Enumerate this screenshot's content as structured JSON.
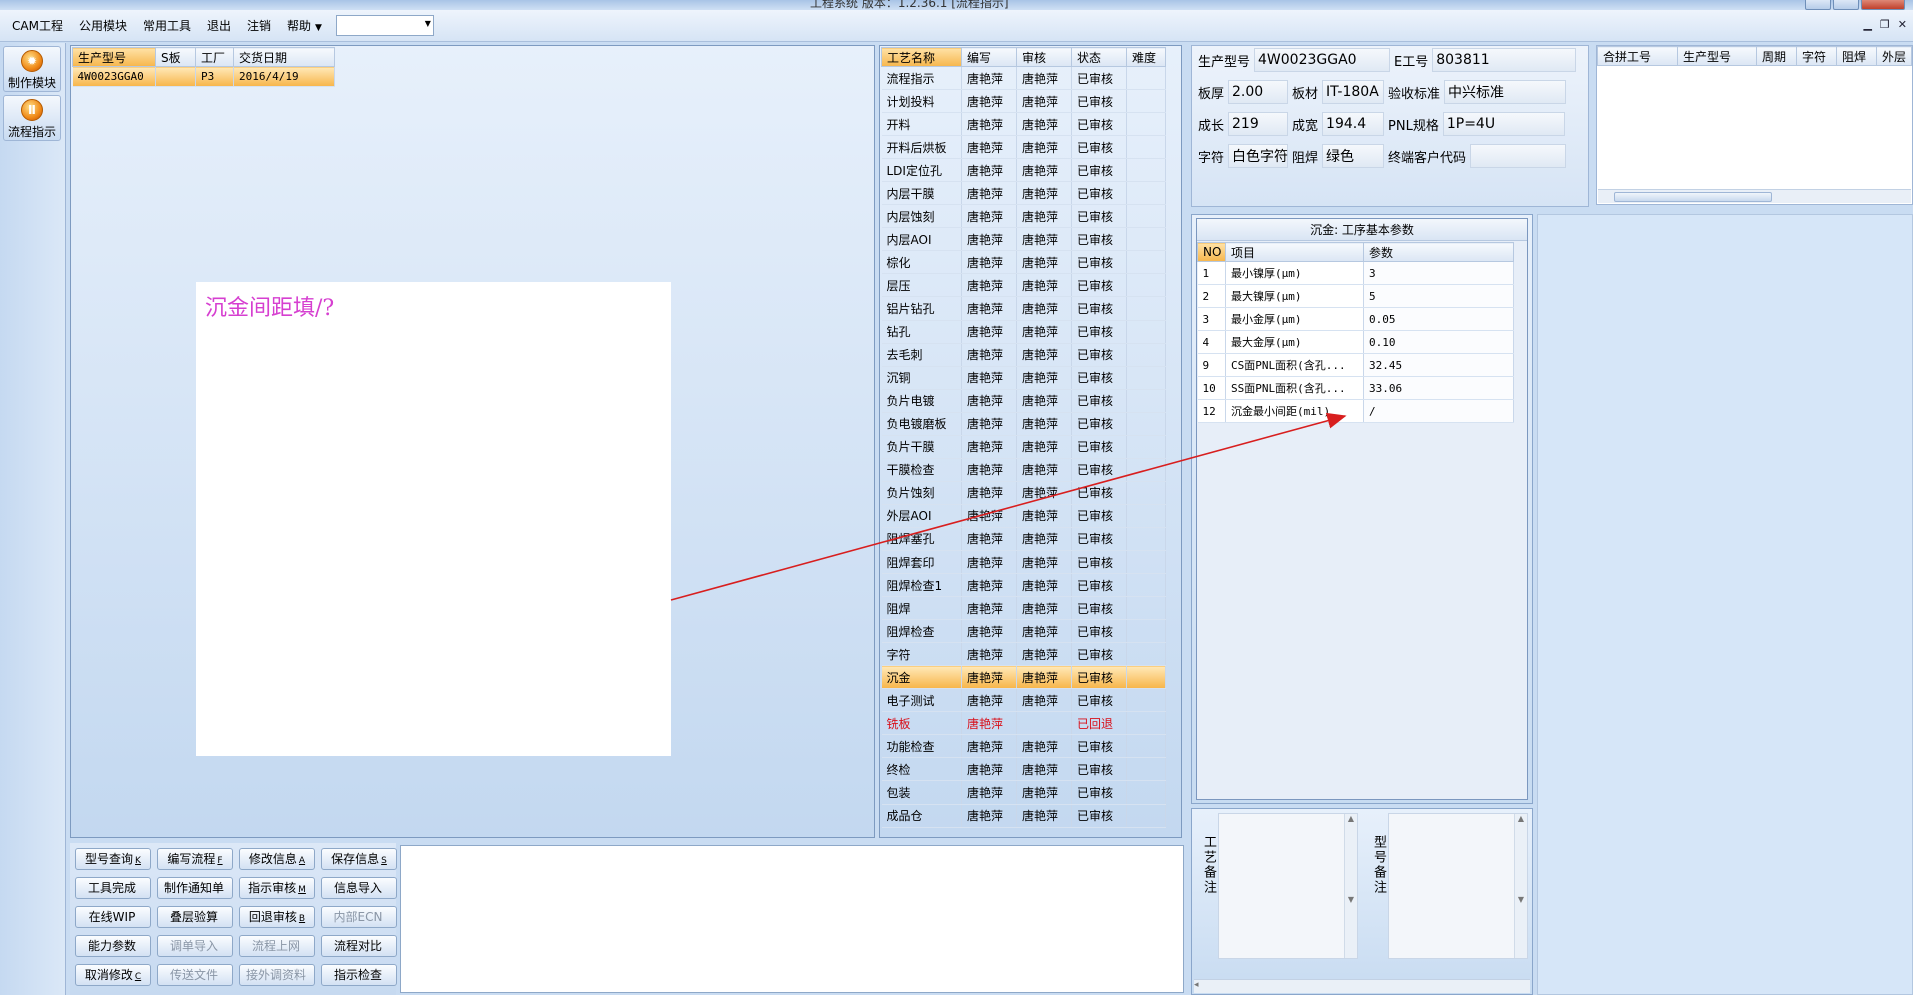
{
  "window": {
    "title": "工程系统   版本：1.2.36.1  [流程指示]"
  },
  "menubar": {
    "items": [
      "CAM工程",
      "公用模块",
      "常用工具",
      "退出",
      "注销",
      "帮助"
    ],
    "combo_value": ""
  },
  "lefttools": {
    "make_module": "制作模块",
    "flow_indicate": "流程指示"
  },
  "orders": {
    "columns": [
      "生产型号",
      "S板",
      "工厂",
      "交货日期"
    ],
    "rows": [
      [
        "4W0023GGA0",
        "",
        "P3",
        "2016/4/19"
      ]
    ]
  },
  "annotation": {
    "text": "沉金间距填/?",
    "arrow_color": "#d81e1e"
  },
  "process": {
    "columns": [
      "工艺名称",
      "编写",
      "审核",
      "状态",
      "难度"
    ],
    "rows": [
      [
        "流程指示",
        "唐艳萍",
        "唐艳萍",
        "已审核",
        ""
      ],
      [
        "计划投料",
        "唐艳萍",
        "唐艳萍",
        "已审核",
        ""
      ],
      [
        "开料",
        "唐艳萍",
        "唐艳萍",
        "已审核",
        ""
      ],
      [
        "开料后烘板",
        "唐艳萍",
        "唐艳萍",
        "已审核",
        ""
      ],
      [
        "LDI定位孔",
        "唐艳萍",
        "唐艳萍",
        "已审核",
        ""
      ],
      [
        "内层干膜",
        "唐艳萍",
        "唐艳萍",
        "已审核",
        ""
      ],
      [
        "内层蚀刻",
        "唐艳萍",
        "唐艳萍",
        "已审核",
        ""
      ],
      [
        "内层AOI",
        "唐艳萍",
        "唐艳萍",
        "已审核",
        ""
      ],
      [
        "棕化",
        "唐艳萍",
        "唐艳萍",
        "已审核",
        ""
      ],
      [
        "层压",
        "唐艳萍",
        "唐艳萍",
        "已审核",
        ""
      ],
      [
        "铝片钻孔",
        "唐艳萍",
        "唐艳萍",
        "已审核",
        ""
      ],
      [
        "钻孔",
        "唐艳萍",
        "唐艳萍",
        "已审核",
        ""
      ],
      [
        "去毛刺",
        "唐艳萍",
        "唐艳萍",
        "已审核",
        ""
      ],
      [
        "沉铜",
        "唐艳萍",
        "唐艳萍",
        "已审核",
        ""
      ],
      [
        "负片电镀",
        "唐艳萍",
        "唐艳萍",
        "已审核",
        ""
      ],
      [
        "负电镀磨板",
        "唐艳萍",
        "唐艳萍",
        "已审核",
        ""
      ],
      [
        "负片干膜",
        "唐艳萍",
        "唐艳萍",
        "已审核",
        ""
      ],
      [
        "干膜检查",
        "唐艳萍",
        "唐艳萍",
        "已审核",
        ""
      ],
      [
        "负片蚀刻",
        "唐艳萍",
        "唐艳萍",
        "已审核",
        ""
      ],
      [
        "外层AOI",
        "唐艳萍",
        "唐艳萍",
        "已审核",
        ""
      ],
      [
        "阻焊塞孔",
        "唐艳萍",
        "唐艳萍",
        "已审核",
        ""
      ],
      [
        "阻焊套印",
        "唐艳萍",
        "唐艳萍",
        "已审核",
        ""
      ],
      [
        "阻焊检查1",
        "唐艳萍",
        "唐艳萍",
        "已审核",
        ""
      ],
      [
        "阻焊",
        "唐艳萍",
        "唐艳萍",
        "已审核",
        ""
      ],
      [
        "阻焊检查",
        "唐艳萍",
        "唐艳萍",
        "已审核",
        ""
      ],
      [
        "字符",
        "唐艳萍",
        "唐艳萍",
        "已审核",
        ""
      ],
      [
        "沉金",
        "唐艳萍",
        "唐艳萍",
        "已审核",
        ""
      ],
      [
        "电子测试",
        "唐艳萍",
        "唐艳萍",
        "已审核",
        ""
      ],
      [
        "铣板",
        "唐艳萍",
        "",
        "已回退",
        ""
      ],
      [
        "功能检查",
        "唐艳萍",
        "唐艳萍",
        "已审核",
        ""
      ],
      [
        "终检",
        "唐艳萍",
        "唐艳萍",
        "已审核",
        ""
      ],
      [
        "包装",
        "唐艳萍",
        "唐艳萍",
        "已审核",
        ""
      ],
      [
        "成品仓",
        "唐艳萍",
        "唐艳萍",
        "已审核",
        ""
      ]
    ],
    "selected_index": 26,
    "returned_index": 28,
    "returned_color": "#d8101a"
  },
  "info": {
    "model_label": "生产型号",
    "model": "4W0023GGA0",
    "eno_label": "E工号",
    "eno": "803811",
    "thickness_label": "板厚",
    "thickness": "2.00",
    "material_label": "板材",
    "material": "IT-180A",
    "accept_label": "验收标准",
    "accept": "中兴标准",
    "length_label": "成长",
    "length": "219",
    "width_label": "成宽",
    "width": "194.4",
    "pnl_label": "PNL规格",
    "pnl": "1P=4U",
    "char_label": "字符",
    "char": "白色字符",
    "mask_label": "阻焊",
    "mask": "绿色",
    "customer_label": "终端客户代码",
    "customer": ""
  },
  "merge": {
    "columns": [
      "合拼工号",
      "生产型号",
      "周期",
      "字符",
      "阻焊",
      "外层"
    ]
  },
  "params": {
    "title": "沉金: 工序基本参数",
    "columns": [
      "NO",
      "项目",
      "参数"
    ],
    "rows": [
      [
        "1",
        "最小镍厚(μm)",
        "3"
      ],
      [
        "2",
        "最大镍厚(μm)",
        "5"
      ],
      [
        "3",
        "最小金厚(μm)",
        "0.05"
      ],
      [
        "4",
        "最大金厚(μm)",
        "0.10"
      ],
      [
        "9",
        "CS面PNL面积(含孔...",
        "32.45"
      ],
      [
        "10",
        "SS面PNL面积(含孔...",
        "33.06"
      ],
      [
        "12",
        "沉金最小间距(mil)",
        "/"
      ]
    ]
  },
  "notes": {
    "process_label": "工艺备注",
    "model_label": "型号备注"
  },
  "buttons": [
    {
      "label": "型号查询",
      "key": "K",
      "enabled": true
    },
    {
      "label": "编写流程",
      "key": "F",
      "enabled": true
    },
    {
      "label": "修改信息",
      "key": "A",
      "enabled": true
    },
    {
      "label": "保存信息",
      "key": "S",
      "enabled": true
    },
    {
      "label": "工具完成",
      "key": "",
      "enabled": true
    },
    {
      "label": "制作通知单",
      "key": "",
      "enabled": true
    },
    {
      "label": "指示审核",
      "key": "M",
      "enabled": true
    },
    {
      "label": "信息导入",
      "key": "",
      "enabled": true
    },
    {
      "label": "在线WIP",
      "key": "",
      "enabled": true
    },
    {
      "label": "叠层验算",
      "key": "",
      "enabled": true
    },
    {
      "label": "回退审核",
      "key": "B",
      "enabled": true
    },
    {
      "label": "内部ECN",
      "key": "",
      "enabled": false
    },
    {
      "label": "能力参数",
      "key": "",
      "enabled": true
    },
    {
      "label": "调单导入",
      "key": "",
      "enabled": false
    },
    {
      "label": "流程上网",
      "key": "",
      "enabled": false
    },
    {
      "label": "流程对比",
      "key": "",
      "enabled": true
    },
    {
      "label": "取消修改",
      "key": "C",
      "enabled": true
    },
    {
      "label": "传送文件",
      "key": "",
      "enabled": false
    },
    {
      "label": "接外调资料",
      "key": "",
      "enabled": false
    },
    {
      "label": "指示检查",
      "key": "",
      "enabled": true
    }
  ]
}
